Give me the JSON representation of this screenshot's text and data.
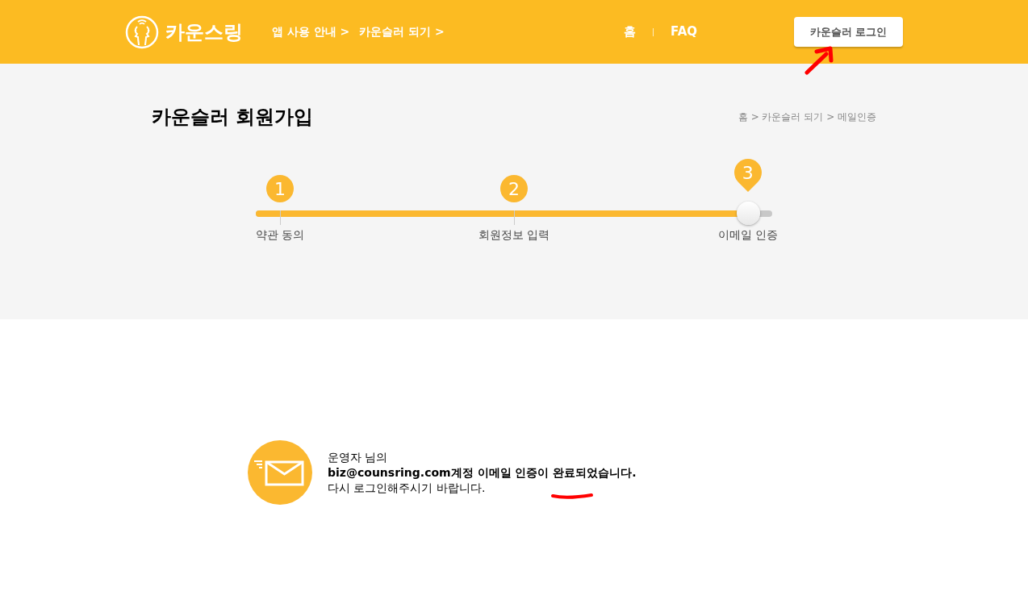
{
  "header": {
    "logo_text": "카운스링",
    "nav": [
      "앱 사용 안내 >",
      "카운슬러 되기 >"
    ],
    "links": [
      "홈",
      "FAQ"
    ],
    "login_button": "카운슬러 로그인"
  },
  "page": {
    "title": "카운슬러 회원가입",
    "breadcrumb": "홈 > 카운슬러 되기 > 메일인증"
  },
  "progress": {
    "level": 0.953,
    "steps": [
      {
        "number": "1",
        "label": "약관 동의",
        "selected": false
      },
      {
        "number": "2",
        "label": "회원정보 입력",
        "selected": false
      },
      {
        "number": "3",
        "label": "이메일 인증",
        "selected": true
      }
    ]
  },
  "message": {
    "lines": [
      "운영자 님의",
      "biz@counsring.com계정 이메일 인증이 완료되었습니다.",
      "다시 로그인해주시기 바랍니다."
    ]
  }
}
